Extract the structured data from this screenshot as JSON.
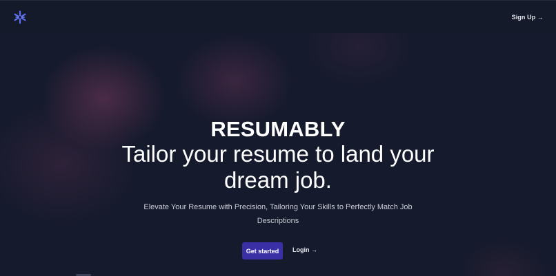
{
  "navbar": {
    "logo_icon": "snowflake-star-icon",
    "signup_label": "Sign Up →"
  },
  "hero": {
    "title": "RESUMABLY",
    "headline": "Tailor your resume to land your dream job.",
    "subtitle": "Elevate Your Resume with Precision, Tailoring Your Skills to Perfectly Match Job Descriptions",
    "primary_button_label": "Get started",
    "login_label": "Login →"
  },
  "colors": {
    "background": "#151a2c",
    "accent_button": "#3b2fa6",
    "logo": "#5b6ef0",
    "text": "#ffffff"
  }
}
